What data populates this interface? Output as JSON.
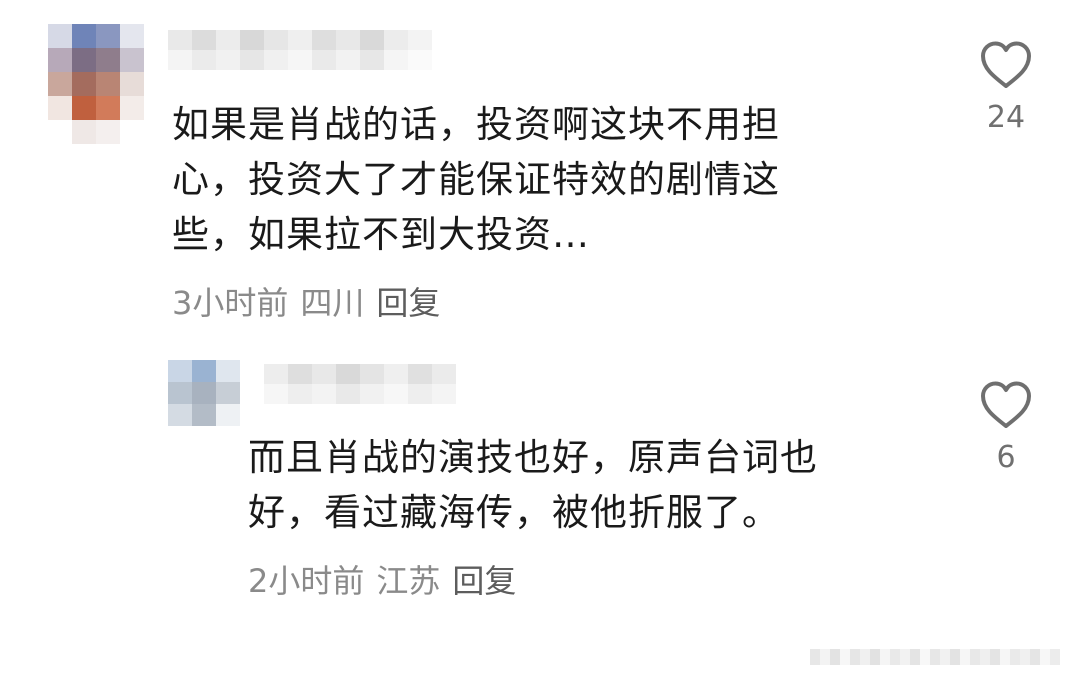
{
  "comments": [
    {
      "text": "如果是肖战的话，投资啊这块不用担心，投资大了才能保证特效的剧情这些，如果拉不到大投资…",
      "lines": [
        "如果是肖战的话，投资啊这块不用担",
        "心，投资大了才能保证特效的剧情这",
        "些，如果拉不到大投资…"
      ],
      "time": "3小时前",
      "location": "四川",
      "reply_label": "回复",
      "likes": "24"
    },
    {
      "text": "而且肖战的演技也好，原声台词也好，看过藏海传，被他折服了。",
      "lines": [
        "而且肖战的演技也好，原声台词也",
        "好，看过藏海传，被他折服了。"
      ],
      "time": "2小时前",
      "location": "江苏",
      "reply_label": "回复",
      "likes": "6"
    }
  ],
  "icons": {
    "like": "heart-outline-icon"
  },
  "colors": {
    "text": "#1a1a1a",
    "meta": "#8a8a8a",
    "icon": "#6f6f6f"
  }
}
